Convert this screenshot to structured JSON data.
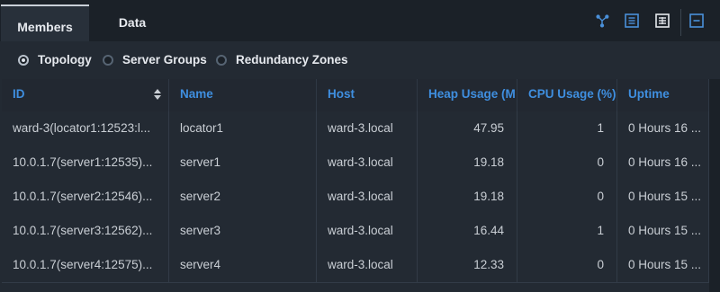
{
  "tabs": [
    {
      "label": "Members",
      "active": true
    },
    {
      "label": "Data",
      "active": false
    }
  ],
  "toolbar": {
    "icons": [
      "topology-icon",
      "panel-view-icon",
      "grid-view-icon",
      "minimize-icon"
    ]
  },
  "view_options": [
    {
      "label": "Topology",
      "selected": true
    },
    {
      "label": "Server Groups",
      "selected": false
    },
    {
      "label": "Redundancy Zones",
      "selected": false
    }
  ],
  "table": {
    "columns": [
      "ID",
      "Name",
      "Host",
      "Heap Usage (M",
      "CPU Usage (%)",
      "Uptime"
    ],
    "sort_column": "ID",
    "rows": [
      [
        "ward-3(locator1:12523:l...",
        "locator1",
        "ward-3.local",
        "47.95",
        "1",
        "0 Hours 16 ..."
      ],
      [
        "10.0.1.7(server1:12535)...",
        "server1",
        "ward-3.local",
        "19.18",
        "0",
        "0 Hours 16 ..."
      ],
      [
        "10.0.1.7(server2:12546)...",
        "server2",
        "ward-3.local",
        "19.18",
        "0",
        "0 Hours 15 ..."
      ],
      [
        "10.0.1.7(server3:12562)...",
        "server3",
        "ward-3.local",
        "16.44",
        "1",
        "0 Hours 15 ..."
      ],
      [
        "10.0.1.7(server4:12575)...",
        "server4",
        "ward-3.local",
        "12.33",
        "0",
        "0 Hours 15 ..."
      ]
    ]
  },
  "colors": {
    "header_text": "#3f8fe0",
    "accent_icon": "#4a90d9",
    "background": "#232a33"
  }
}
